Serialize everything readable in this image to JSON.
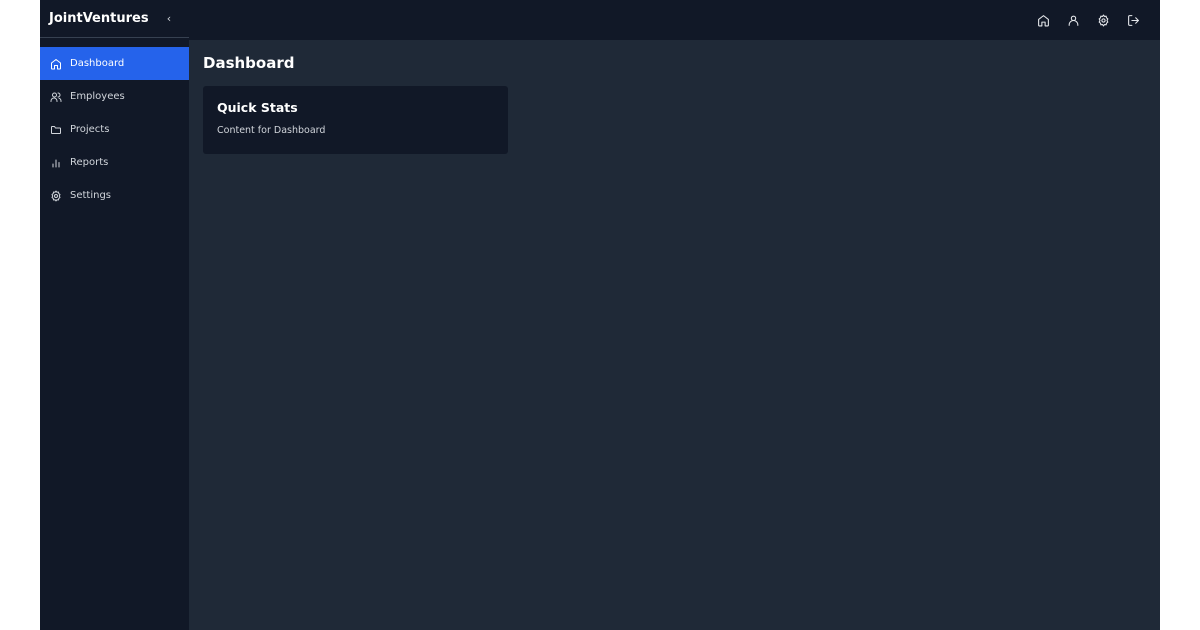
{
  "sidebar": {
    "brand": "JointVentures",
    "collapse_glyph": "‹",
    "items": [
      {
        "label": "Dashboard",
        "icon": "home-icon",
        "active": true
      },
      {
        "label": "Employees",
        "icon": "users-icon",
        "active": false
      },
      {
        "label": "Projects",
        "icon": "folder-icon",
        "active": false
      },
      {
        "label": "Reports",
        "icon": "bar-chart-icon",
        "active": false
      },
      {
        "label": "Settings",
        "icon": "gear-icon",
        "active": false
      }
    ]
  },
  "topbar": {
    "icons": [
      "home-icon",
      "user-icon",
      "gear-icon",
      "logout-icon"
    ]
  },
  "main": {
    "title": "Dashboard",
    "card": {
      "title": "Quick Stats",
      "body": "Content for Dashboard"
    }
  },
  "colors": {
    "sidebar_bg": "#111827",
    "main_bg": "#1f2937",
    "accent": "#2563eb",
    "text": "#ffffff",
    "muted_text": "#d1d5db"
  }
}
